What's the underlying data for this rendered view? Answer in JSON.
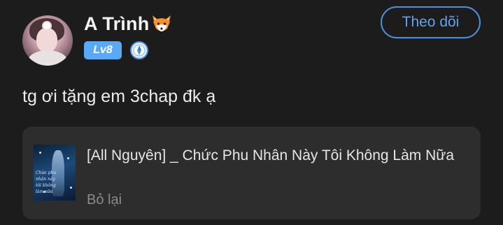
{
  "user": {
    "name": "A Trình",
    "name_emoji_icon": "fox-face-icon",
    "level": "Lv8",
    "verified_icon": "verified-badge-icon",
    "avatar_icon": "user-avatar-photo"
  },
  "follow_button": {
    "label": "Theo dõi"
  },
  "comment": {
    "text": "tg ơi tặng em 3chap đk ạ"
  },
  "shared_story": {
    "title": "[All Nguyên] _ Chức Phu Nhân Này Tôi Không Làm Nữa",
    "subtitle": "Bỏ lại",
    "cover_script_lines": [
      "Chức phu",
      "nhân này",
      "tôi không",
      "làm nữa"
    ]
  },
  "colors": {
    "background": "#1c1c1c",
    "card_background": "#2d2d2d",
    "accent_blue": "#5fa2f0",
    "level_badge": "#5aa9f6",
    "muted_text": "#8a8a8a"
  }
}
